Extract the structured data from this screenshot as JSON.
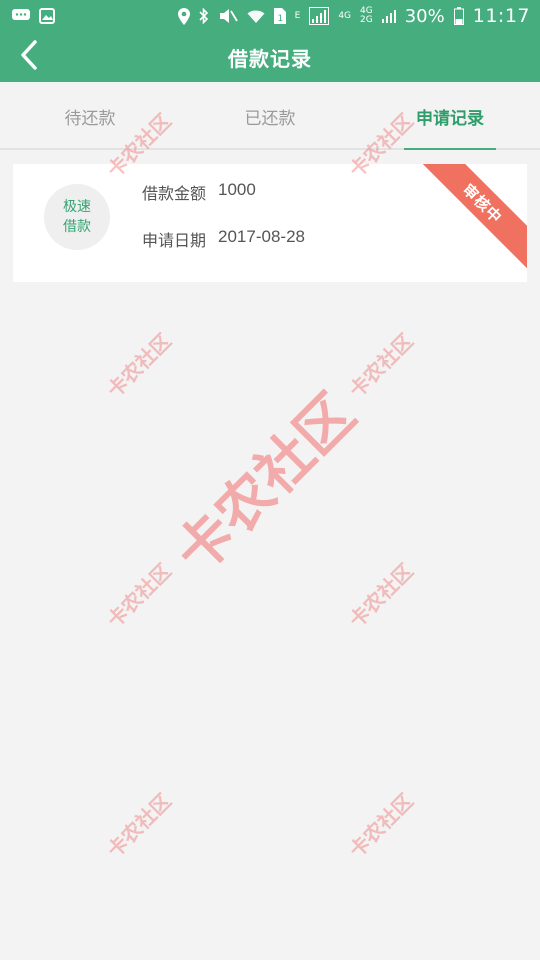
{
  "status_bar": {
    "battery_percent": "30%",
    "time": "11:17",
    "network_labels": [
      "4G",
      "4G",
      "2G"
    ],
    "icons": [
      "message-icon",
      "image-icon",
      "location-icon",
      "bluetooth-icon",
      "mute-icon",
      "wifi-icon",
      "sim-icon",
      "signal-icon",
      "battery-icon"
    ]
  },
  "header": {
    "title": "借款记录"
  },
  "tabs": [
    {
      "label": "待还款",
      "active": false
    },
    {
      "label": "已还款",
      "active": false
    },
    {
      "label": "申请记录",
      "active": true
    }
  ],
  "record": {
    "product_line1": "极速",
    "product_line2": "借款",
    "amount_label": "借款金额",
    "amount_value": "1000",
    "date_label": "申请日期",
    "date_value": "2017-08-28",
    "status": "审核中"
  },
  "watermark": {
    "text": "卡农社区"
  },
  "colors": {
    "primary": "#46ad7f",
    "active_tab": "#2f9e6c",
    "ribbon": "#f0715f",
    "background": "#f3f3f3"
  }
}
